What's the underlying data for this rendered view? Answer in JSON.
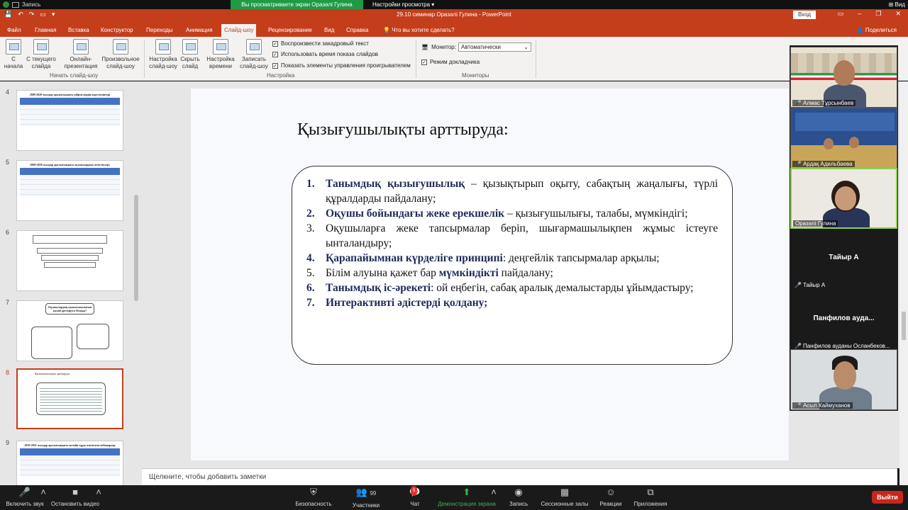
{
  "zoom_top": {
    "recording": "Запись",
    "share_banner": "Вы просматриваете экран Оразәлі Гулина",
    "view_options": "Настройки просмотра",
    "view": "Вид"
  },
  "window": {
    "title": "29.10 симинар Оразәлі Гулина  -  PowerPoint",
    "signin": "Вход"
  },
  "tabs": [
    "Файл",
    "Главная",
    "Вставка",
    "Конструктор",
    "Переходы",
    "Анимация",
    "Слайд-шоу",
    "Рецензирование",
    "Вид",
    "Справка",
    "Что вы хотите сделать?"
  ],
  "active_tab": "Слайд-шоу",
  "share_label": "Поделиться",
  "ribbon": {
    "from_start": "С начала",
    "from_current": "С текущего слайда",
    "online": "Онлайн-презентация",
    "custom": "Произвольное слайд-шоу",
    "group_start": "Начать слайд-шоу",
    "setup": "Настройка слайд-шоу",
    "hide": "Скрыть слайд",
    "rehearse": "Настройка времени",
    "record": "Записать слайд-шоу",
    "chk_narration": "Воспроизвести закадровый текст",
    "chk_timings": "Использовать время показа слайдов",
    "chk_controls": "Показать элементы управления проигрывателем",
    "group_setup": "Настройка",
    "monitor_label": "Монитор:",
    "monitor_value": "Автоматически",
    "presenter": "Режим докладчика",
    "group_monitors": "Мониторы"
  },
  "thumbnails": [
    {
      "num": "4",
      "title": "2009-2020 жылдар аралығындағы үйірмелердің көрсеткіштері"
    },
    {
      "num": "5",
      "title": "2009-2020 жылдар аралығындағы оқушылардың жетістіктері"
    },
    {
      "num": "6",
      "title": ""
    },
    {
      "num": "7",
      "title": "Оқушылардың қызығушылығын қалай арттыруға болады?"
    },
    {
      "num": "8",
      "title": "Қызығушылықты арттыруда:"
    },
    {
      "num": "9",
      "title": "2010-2021 жылдар аралығындағы онлайн түрде өткізілген вебинарлар"
    }
  ],
  "slide": {
    "title": "Қызығушылықты арттыруда:",
    "items": [
      {
        "num": "1.",
        "bold": "Танымдық қызығушылық",
        "rest": " – қызықтырып оқыту, сабақтың жаңалығы, түрлі құралдарды пайдалану;"
      },
      {
        "num": "2.",
        "bold": "Оқушы бойындағы жеке ерекшелік",
        "rest": " – қызығушылығы, талабы, мүмкіндігі;"
      },
      {
        "num": "3.",
        "bold": "",
        "rest": "Оқушыларға жеке тапсырмалар беріп, шығармашылықпен жұмыс істеуге ынталандыру;"
      },
      {
        "num": "4.",
        "bold": "Қарапайымнан күрделіге принципі",
        "rest": ": деңгейлік тапсырмалар арқылы;"
      },
      {
        "num": "5.",
        "pre": "Білім алуына қажет бар ",
        "bold": "мүмкіндікті",
        "rest": " пайдалану;"
      },
      {
        "num": "6.",
        "bold": "Танымдық іс-әрекеті",
        "rest": ": ой еңбегін, сабақ аралық демалыстарды ұйымдастыру;"
      },
      {
        "num": "7.",
        "bold": "Интерактивті әдістерді қолдану;",
        "rest": ""
      }
    ]
  },
  "notes_placeholder": "Щелкните, чтобы добавить заметки",
  "participants": [
    {
      "name": "Алмас Тұрсынбаев"
    },
    {
      "name": "Ардақ Адильбаева"
    },
    {
      "name": "Оразәлі Гулина"
    },
    {
      "name": "Тайыр А",
      "center": "Тайыр А"
    },
    {
      "name": "Панфилов ауданы Осланбеков...",
      "center": "Панфилов  ауда..."
    },
    {
      "name": "Асыл Каймуханов"
    }
  ],
  "toolbar": {
    "mute": "Включить звук",
    "video": "Остановить видео",
    "security": "Безопасность",
    "participants": "Участники",
    "participants_count": "99",
    "chat": "Чат",
    "chat_badge": "5",
    "share": "Демонстрация экрана",
    "record": "Запись",
    "rooms": "Сессионные залы",
    "reactions": "Реакции",
    "apps": "Приложения",
    "end": "Выйти"
  }
}
